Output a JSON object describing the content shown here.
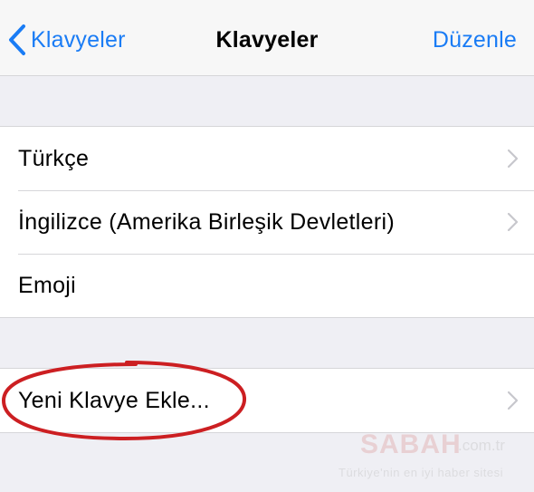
{
  "navbar": {
    "back_label": "Klavyeler",
    "title": "Klavyeler",
    "edit_label": "Düzenle"
  },
  "keyboards": [
    {
      "label": "Türkçe",
      "has_chevron": true
    },
    {
      "label": "İngilizce (Amerika Birleşik Devletleri)",
      "has_chevron": true
    },
    {
      "label": "Emoji",
      "has_chevron": false
    }
  ],
  "add_keyboard": {
    "label": "Yeni Klavye Ekle...",
    "has_chevron": true
  },
  "watermark": {
    "logo": "SABAH",
    "domain": ".com.tr",
    "slogan": "Türkiye'nin en iyi haber sitesi"
  },
  "colors": {
    "accent": "#1a7cf5",
    "highlight": "#cc1f22",
    "background": "#efeff4",
    "separator": "#d6d6d9",
    "chevron": "#c7c7cc"
  },
  "icons": {
    "back": "chevron-left-icon",
    "disclosure": "chevron-right-icon"
  }
}
